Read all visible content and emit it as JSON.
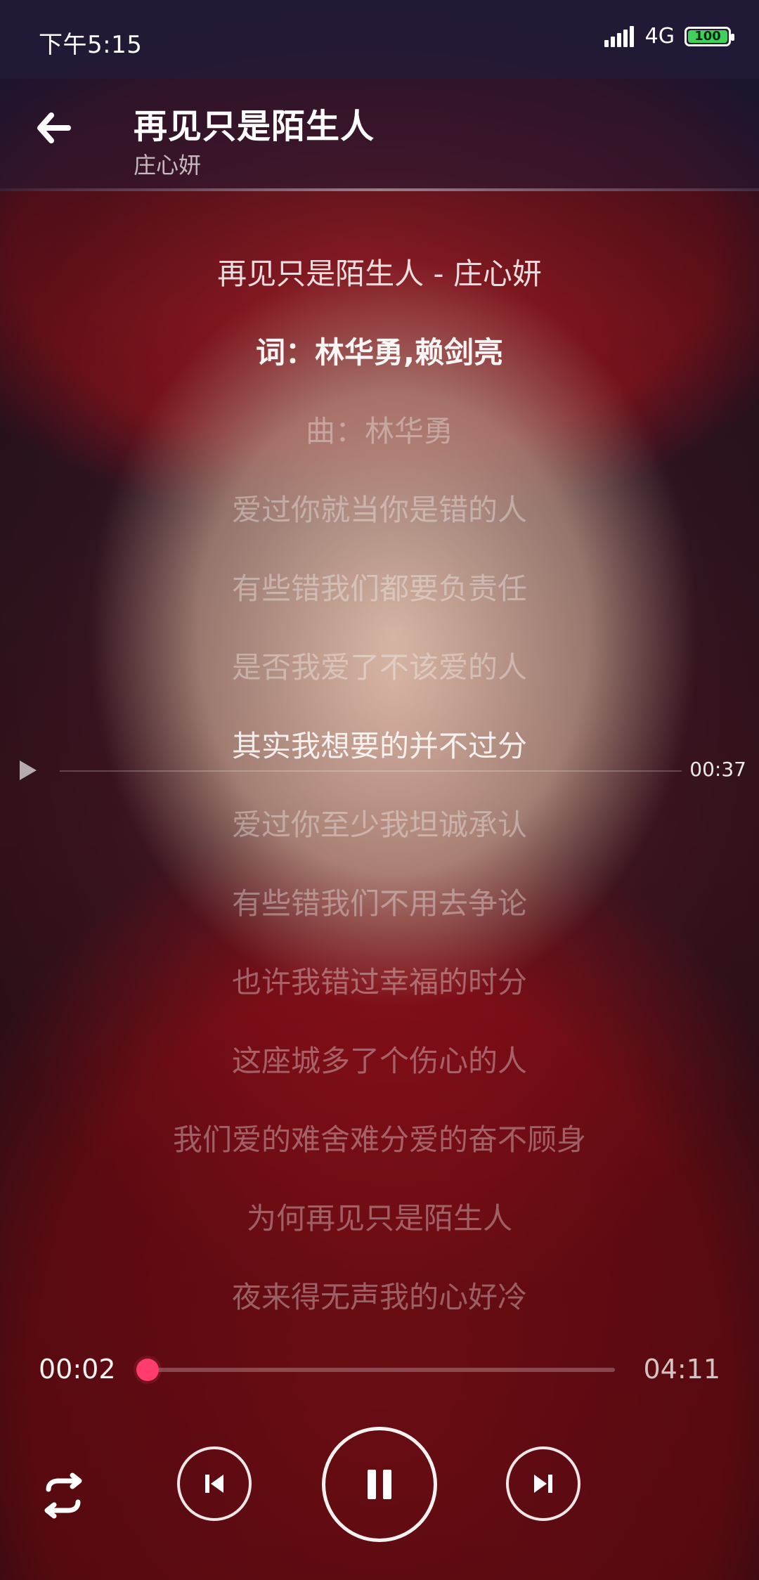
{
  "status_bar": {
    "time": "下午5:15",
    "network": "4G",
    "battery": "100",
    "battery_color": "#3fd15a"
  },
  "header": {
    "title": "再见只是陌生人",
    "artist": "庄心妍",
    "back_icon": "back-arrow-icon"
  },
  "lyrics": {
    "lines": [
      {
        "text": "再见只是陌生人 - 庄心妍",
        "state": "bright"
      },
      {
        "text": "词：林华勇,赖剑亮",
        "state": "active"
      },
      {
        "text": "曲：林华勇",
        "state": "dim"
      },
      {
        "text": "爱过你就当你是错的人",
        "state": "dim"
      },
      {
        "text": "有些错我们都要负责任",
        "state": "dim"
      },
      {
        "text": "是否我爱了不该爱的人",
        "state": "dim"
      },
      {
        "text": "其实我想要的并不过分",
        "state": "bright"
      },
      {
        "text": "爱过你至少我坦诚承认",
        "state": "dim"
      },
      {
        "text": "有些错我们不用去争论",
        "state": "dim"
      },
      {
        "text": "也许我错过幸福的时分",
        "state": "dim"
      },
      {
        "text": "这座城多了个伤心的人",
        "state": "dim"
      },
      {
        "text": "我们爱的难舍难分爱的奋不顾身",
        "state": "dim"
      },
      {
        "text": "为何再见只是陌生人",
        "state": "dim"
      },
      {
        "text": "夜来得无声我的心好冷",
        "state": "dim"
      }
    ],
    "seek_time": "00:37",
    "seek_icon": "play-triangle-icon"
  },
  "player": {
    "current_time": "00:02",
    "total_time": "04:11",
    "progress_fraction": 0.008,
    "accent_color": "#ff3c6e",
    "controls": {
      "repeat_icon": "repeat-icon",
      "prev_icon": "skip-previous-icon",
      "pause_icon": "pause-icon",
      "next_icon": "skip-next-icon"
    }
  }
}
